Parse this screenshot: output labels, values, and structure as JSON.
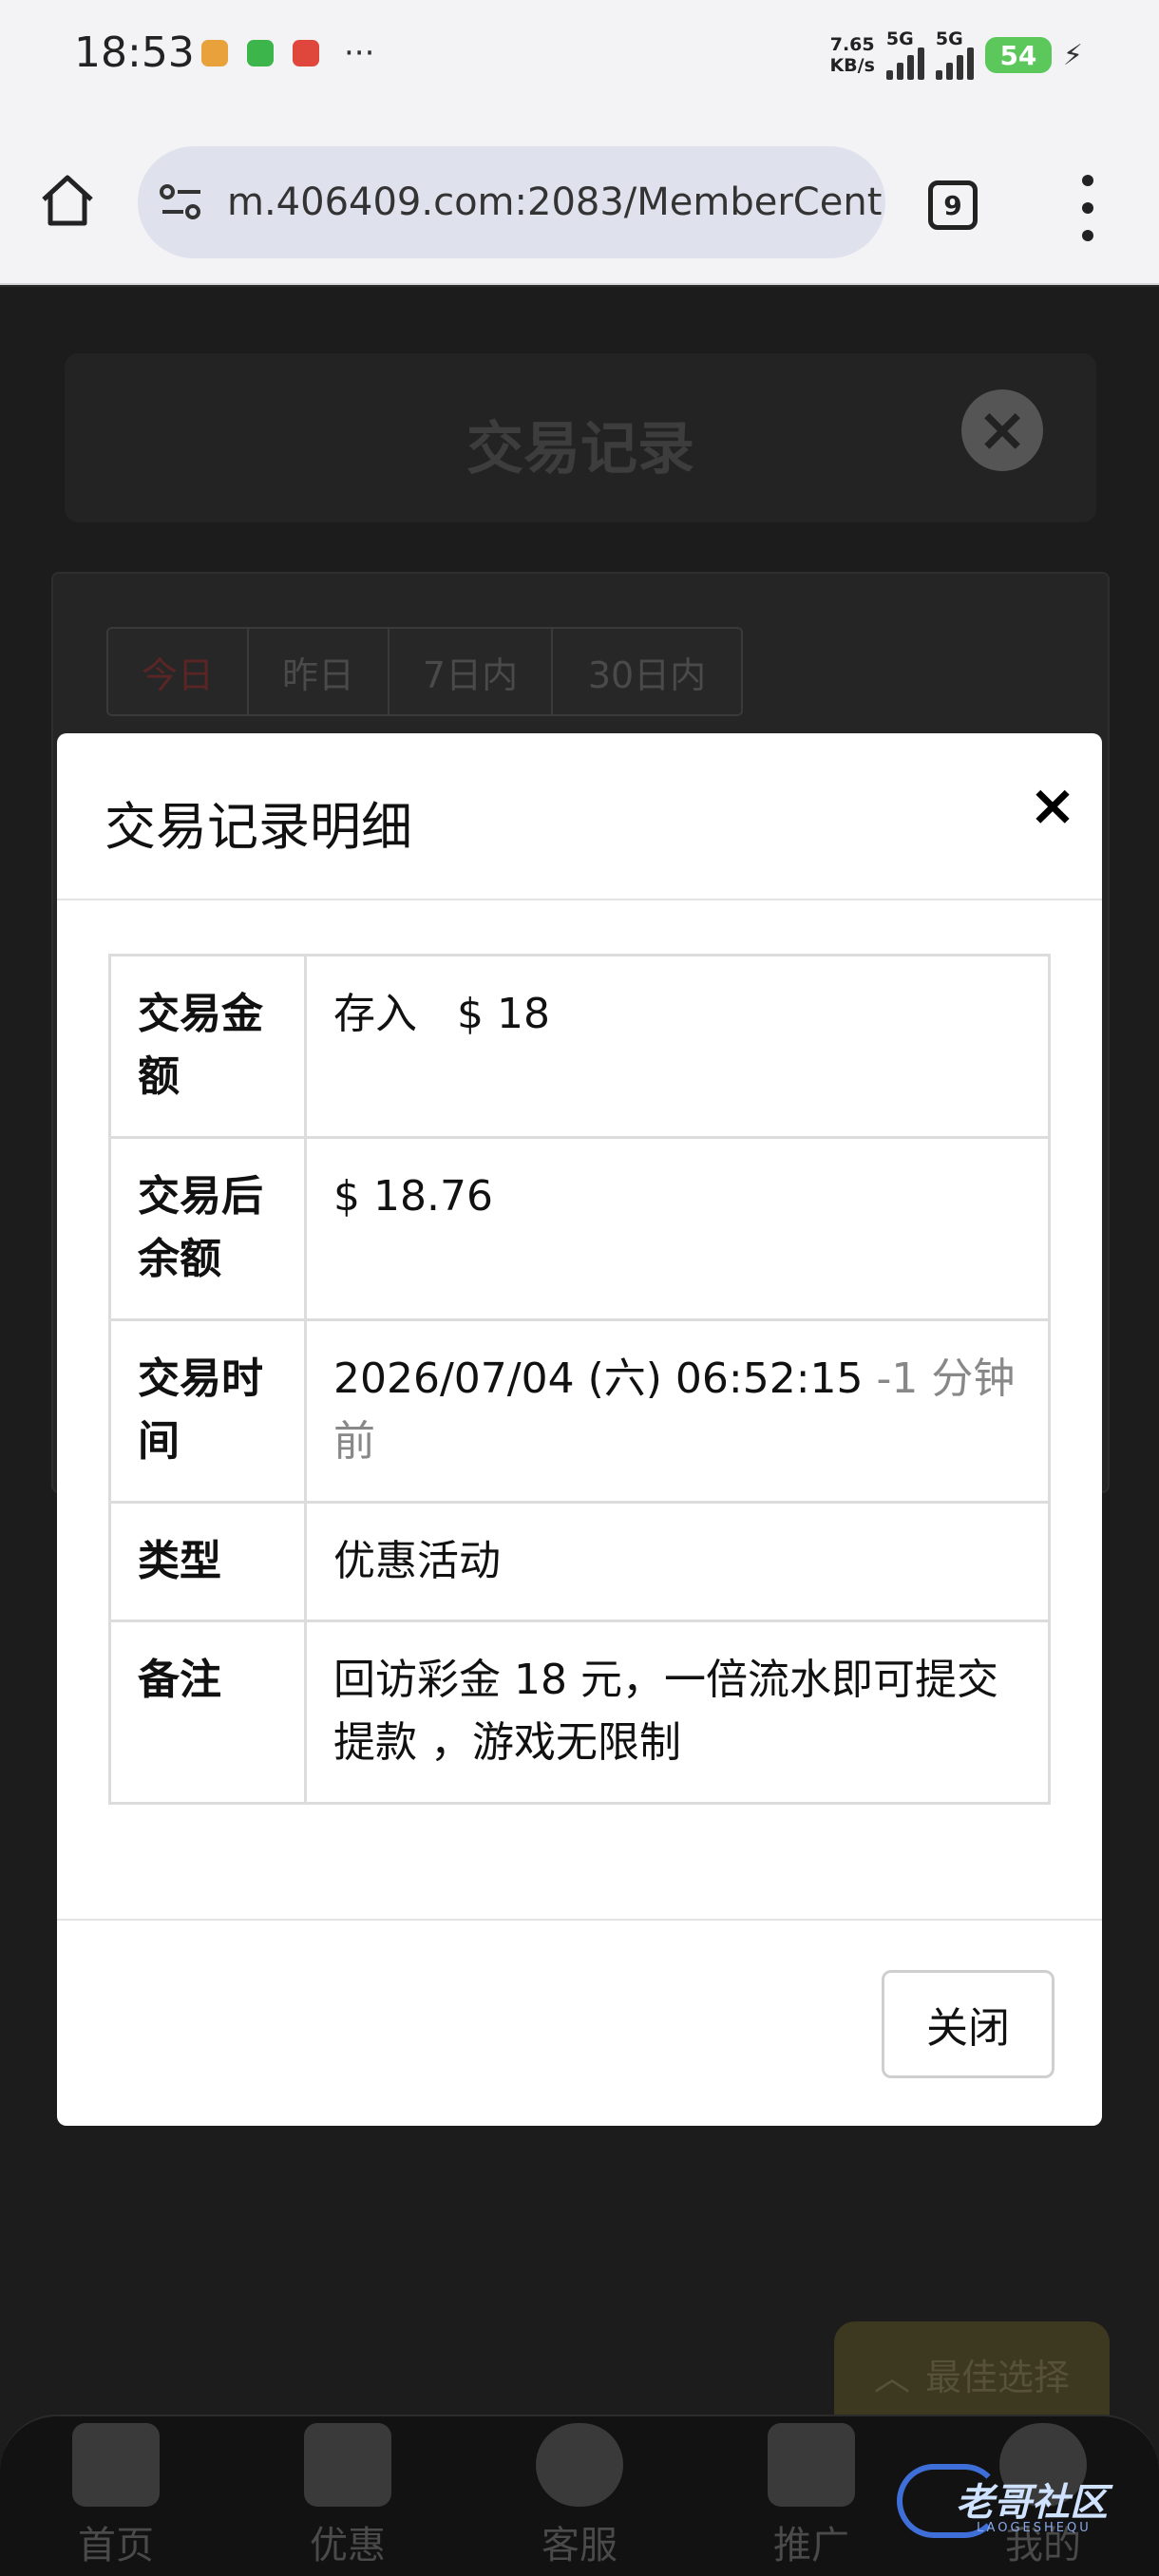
{
  "status_bar": {
    "time": "18:53",
    "more": "···",
    "net_speed_value": "7.65",
    "net_speed_unit": "KB/s",
    "sim1": "5G",
    "sim2": "5G",
    "battery": "54"
  },
  "browser": {
    "url": "m.406409.com:2083/MemberCent",
    "tab_count": "9"
  },
  "background_page": {
    "title": "交易记录",
    "filters": [
      {
        "label": "今日",
        "active": true
      },
      {
        "label": "昨日",
        "active": false
      },
      {
        "label": "7日内",
        "active": false
      },
      {
        "label": "30日内",
        "active": false
      }
    ],
    "best_choice_label": "最佳选择",
    "nav": [
      {
        "label": "首页",
        "icon": "home-icon"
      },
      {
        "label": "优惠",
        "icon": "gift-icon"
      },
      {
        "label": "客服",
        "icon": "headset-icon"
      },
      {
        "label": "推广",
        "icon": "add-user-icon"
      },
      {
        "label": "我的",
        "icon": "profile-icon"
      }
    ],
    "watermark_text": "老哥社区",
    "watermark_sub": "LAOGESHEQU"
  },
  "modal": {
    "title": "交易记录明细",
    "close_symbol": "×",
    "rows": {
      "amount": {
        "label": "交易金额",
        "type_text": "存入",
        "value": "$ 18"
      },
      "balance": {
        "label": "交易后余额",
        "value": "$ 18.76"
      },
      "time": {
        "label": "交易时间",
        "value": "2026/07/04 (六) 06:52:15",
        "relative": "-1 分钟前"
      },
      "category": {
        "label": "类型",
        "value": "优惠活动"
      },
      "note": {
        "label": "备注",
        "value": "回访彩金  18 元，一倍流水即可提交提款 ，游戏无限制"
      }
    },
    "close_button": "关闭"
  },
  "colors": {
    "amount_green": "#3a7a3a",
    "relative_gray": "#888888",
    "battery_green": "#5cc85c"
  }
}
